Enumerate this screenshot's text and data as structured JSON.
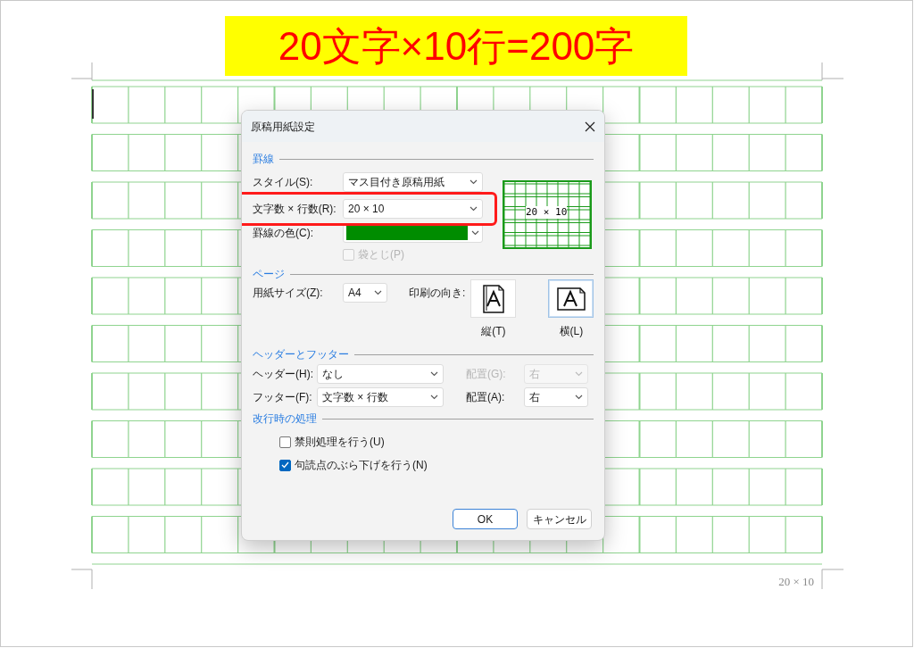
{
  "banner": {
    "text": "20文字×10行=200字"
  },
  "page": {
    "footer_text": "20 × 10"
  },
  "dialog": {
    "title": "原稿用紙設定",
    "ruled_lines": {
      "title": "罫線",
      "style": {
        "label": "スタイル(S):",
        "value": "マス目付き原稿用紙"
      },
      "size": {
        "label": "文字数 × 行数(R):",
        "value": "20 × 10",
        "highlighted": true
      },
      "line_color": {
        "label": "罫線の色(C):",
        "color": "#008c00"
      },
      "binding": {
        "label": "袋とじ(P)",
        "checked": false,
        "disabled": true
      },
      "preview_text": "20 × 10"
    },
    "page_setup": {
      "title": "ページ",
      "paper_size": {
        "label": "用紙サイズ(Z):",
        "value": "A4"
      },
      "orientation": {
        "label": "印刷の向き:",
        "options": [
          {
            "label": "縦(T)",
            "kind": "portrait",
            "selected": false
          },
          {
            "label": "横(L)",
            "kind": "landscape",
            "selected": true
          }
        ]
      }
    },
    "header_footer": {
      "title": "ヘッダーとフッター",
      "rows": [
        {
          "label": "ヘッダー(H):",
          "value": "なし",
          "align_label": "配置(G):",
          "align_value": "右",
          "align_disabled": true
        },
        {
          "label": "フッター(F):",
          "value": "文字数 × 行数",
          "align_label": "配置(A):",
          "align_value": "右",
          "align_disabled": false
        }
      ]
    },
    "line_break": {
      "title": "改行時の処理",
      "options": [
        {
          "label": "禁則処理を行う(U)",
          "checked": false
        },
        {
          "label": "句読点のぶら下げを行う(N)",
          "checked": true
        }
      ]
    },
    "buttons": [
      {
        "label": "OK",
        "default": true
      },
      {
        "label": "キャンセル",
        "default": false
      }
    ]
  }
}
